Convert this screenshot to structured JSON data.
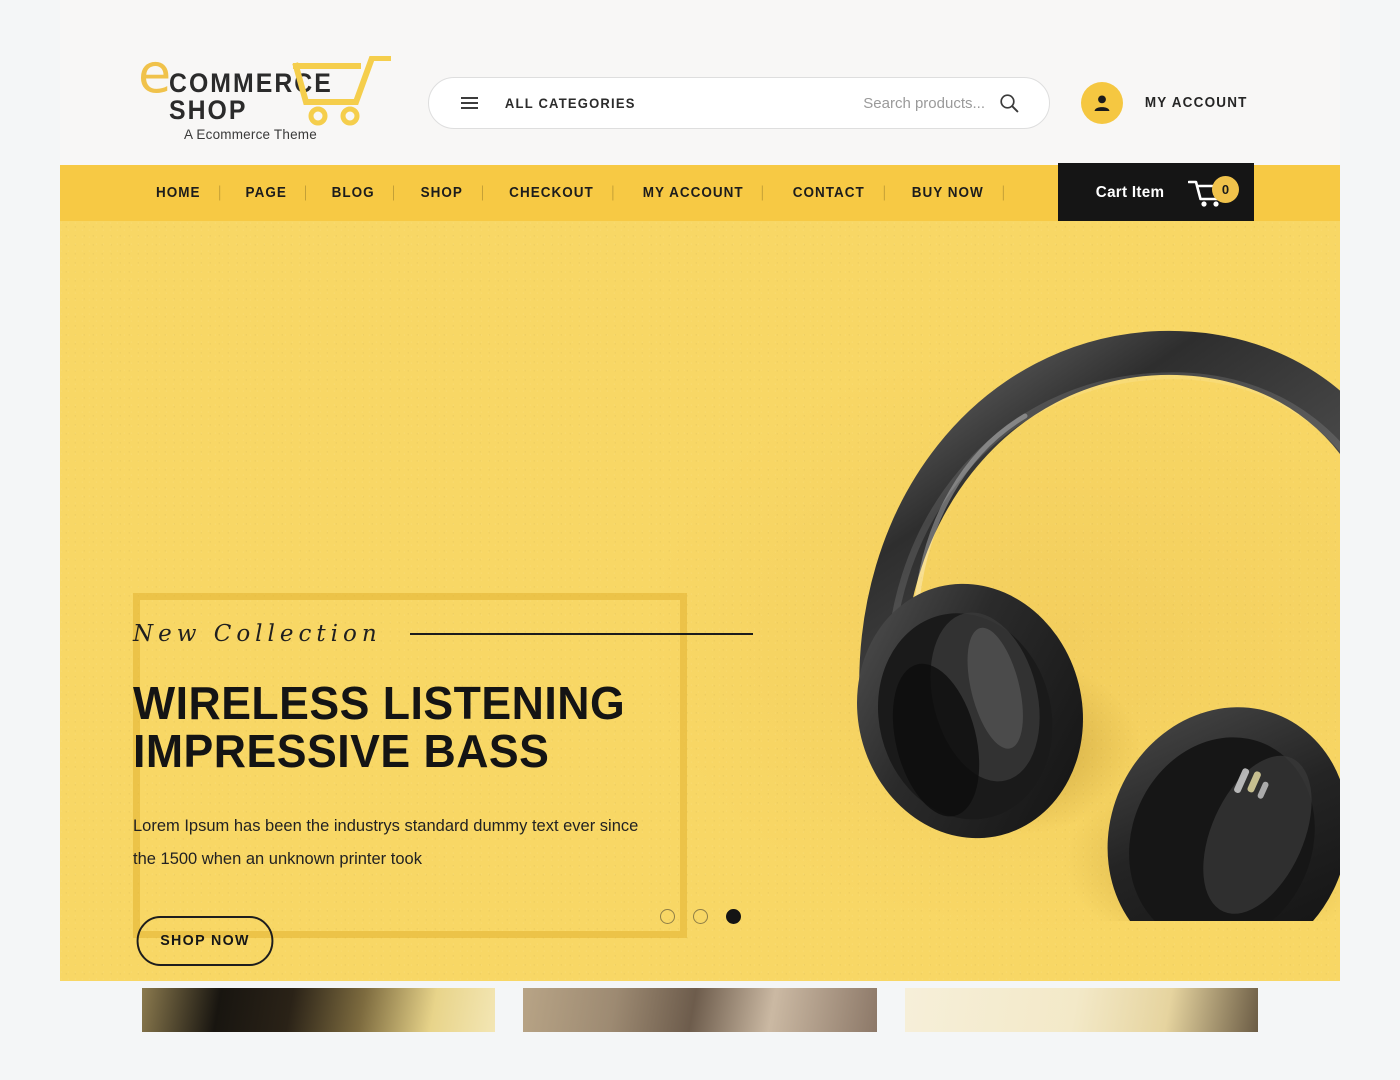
{
  "header": {
    "logo": {
      "initial": "e",
      "word": "COMMERCE SHOP",
      "tagline": "A Ecommerce Theme",
      "cart_icon": "shopping-cart-icon"
    },
    "search": {
      "menu_icon": "hamburger-icon",
      "categories_label": "ALL CATEGORIES",
      "placeholder": "Search products...",
      "value": "",
      "search_icon": "search-icon"
    },
    "account": {
      "avatar_icon": "user-icon",
      "label": "MY ACCOUNT"
    }
  },
  "nav": {
    "items": [
      {
        "label": "HOME"
      },
      {
        "label": "PAGE"
      },
      {
        "label": "BLOG"
      },
      {
        "label": "SHOP"
      },
      {
        "label": "CHECKOUT"
      },
      {
        "label": "MY ACCOUNT"
      },
      {
        "label": "CONTACT"
      },
      {
        "label": "BUY NOW"
      }
    ],
    "cart": {
      "label": "Cart Item",
      "icon": "cart-icon",
      "count": "0"
    }
  },
  "hero": {
    "eyebrow": "New Collection",
    "title_line1": "WIRELESS LISTENING",
    "title_line2": "IMPRESSIVE BASS",
    "description": "Lorem Ipsum has been the industrys standard dummy text ever since the 1500 when an unknown printer took",
    "cta_label": "SHOP NOW",
    "product_image": "black-over-ear-headphones",
    "carousel": {
      "slides": 3,
      "active_index": 2
    }
  },
  "banners": [
    {
      "name": "banner-card-1"
    },
    {
      "name": "banner-card-2"
    },
    {
      "name": "banner-card-3"
    }
  ],
  "colors": {
    "brand_yellow": "#f7c944",
    "hero_yellow": "#f8d763",
    "dark": "#151515",
    "page_bg": "#f4f6f7",
    "header_bg": "#f8f7f6"
  }
}
